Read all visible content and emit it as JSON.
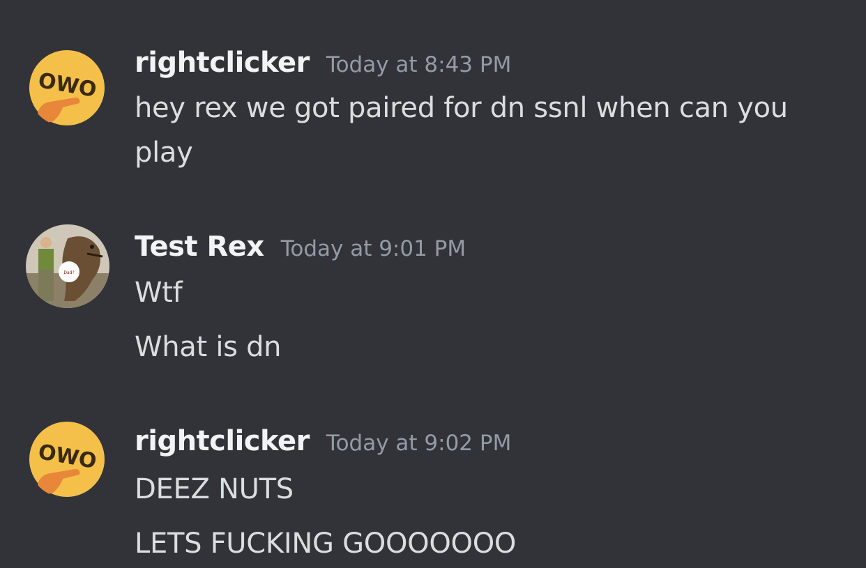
{
  "colors": {
    "background": "#313338",
    "username": "#f2f3f5",
    "timestamp": "#949ba4",
    "message_text": "#dbdee1",
    "owo_face": "#f5c04a",
    "owo_text": "#3a2a12",
    "hand": "#e8873a"
  },
  "messages": [
    {
      "avatar_icon": "owo-pointing-emoji-icon",
      "username": "rightclicker",
      "timestamp": "Today at 8:43 PM",
      "lines": [
        "hey rex we got paired for dn ssnl when can you",
        "play"
      ]
    },
    {
      "avatar_icon": "dinosaur-soldier-photo-icon",
      "username": "Test Rex",
      "timestamp": "Today at 9:01 PM",
      "lines": [
        "Wtf",
        "What is dn"
      ]
    },
    {
      "avatar_icon": "owo-pointing-emoji-icon",
      "username": "rightclicker",
      "timestamp": "Today at 9:02 PM",
      "lines": [
        "DEEZ NUTS",
        "LETS FUCKING GOOOOOOO"
      ]
    }
  ]
}
